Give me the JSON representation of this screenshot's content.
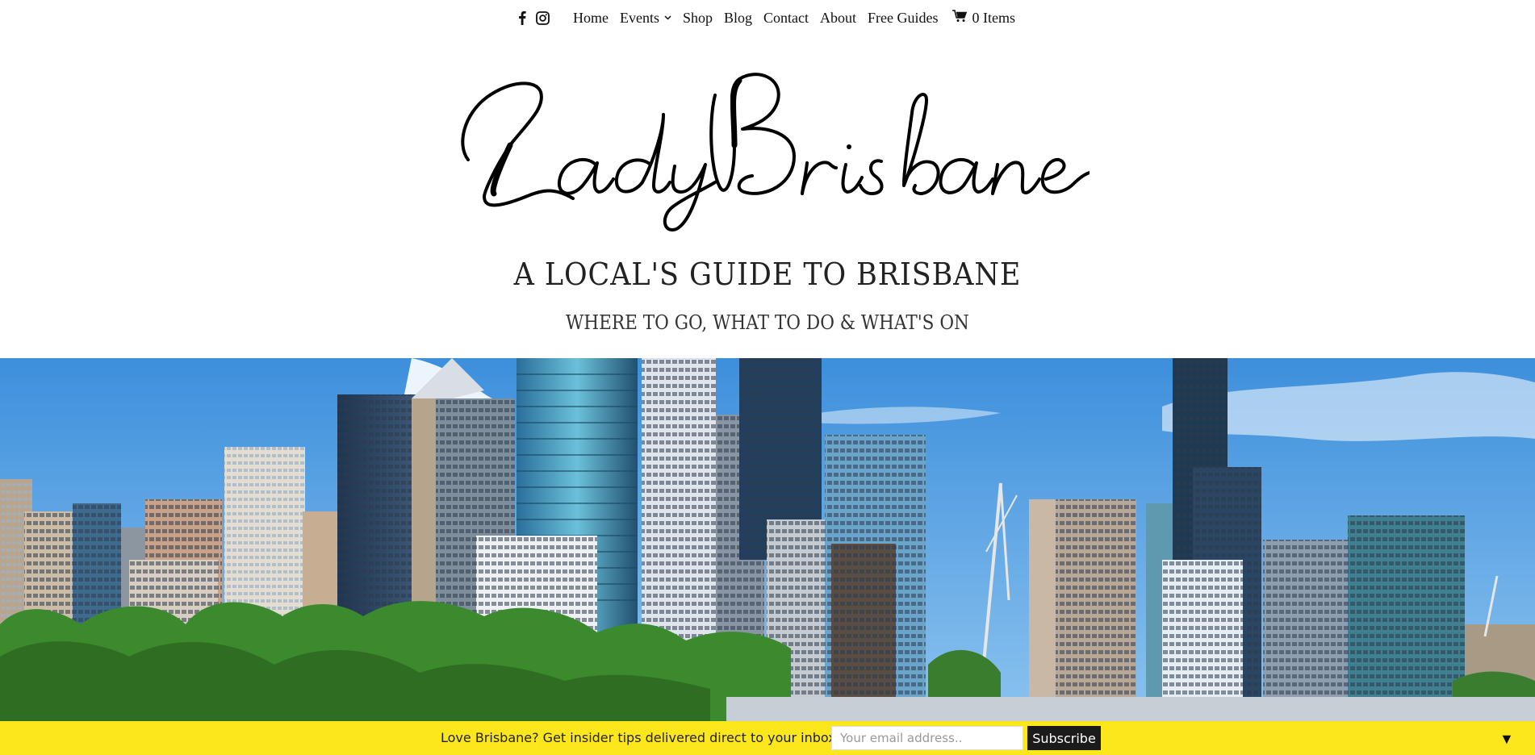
{
  "nav": {
    "social": [
      "facebook-icon",
      "instagram-icon"
    ],
    "items": [
      {
        "label": "Home"
      },
      {
        "label": "Events"
      },
      {
        "label": "Shop"
      },
      {
        "label": "Blog"
      },
      {
        "label": "Contact"
      },
      {
        "label": "About"
      },
      {
        "label": "Free Guides"
      }
    ],
    "cart_label": "0 Items"
  },
  "header": {
    "logo_text": "Lady Brisbane",
    "tagline": "A LOCAL'S GUIDE TO BRISBANE",
    "subtagline": "WHERE TO GO, WHAT TO DO & WHAT'S ON"
  },
  "subscribe": {
    "message": "Love Brisbane? Get insider tips delivered direct to your inbox",
    "email_placeholder": "Your email address..",
    "button_label": "Subscribe",
    "toggle_icon": "▼"
  },
  "colors": {
    "bar": "#fce61c",
    "button": "#1b1b1b",
    "sky": "#4d9be0"
  }
}
